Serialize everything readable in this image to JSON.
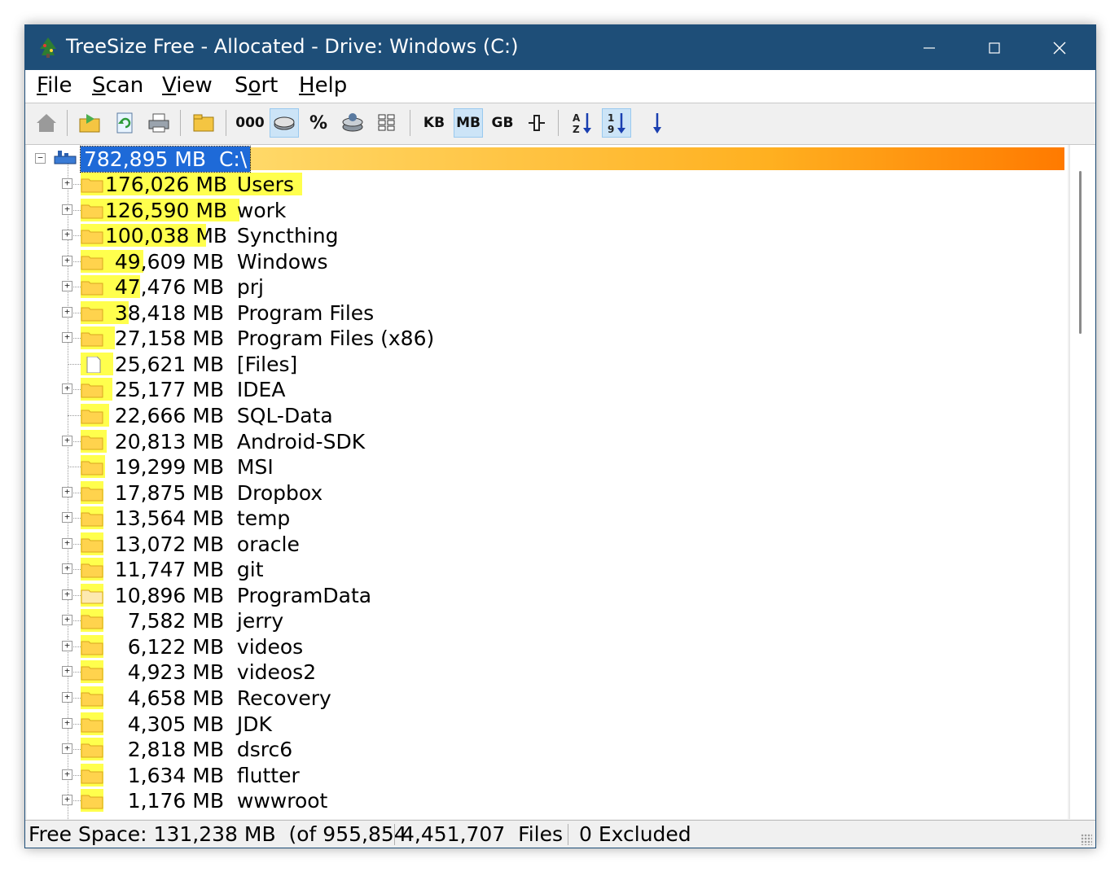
{
  "window": {
    "title": "TreeSize Free - Allocated - Drive: Windows (C:)",
    "controls": {
      "minimize": "–",
      "maximize": "☐",
      "close": "✕"
    }
  },
  "menu": {
    "items": [
      {
        "accel": "F",
        "rest": "ile"
      },
      {
        "accel": "S",
        "rest": "can"
      },
      {
        "accel": "V",
        "rest": "iew"
      },
      {
        "pre": "S",
        "accel": "o",
        "rest": "rt"
      },
      {
        "accel": "H",
        "rest": "elp"
      }
    ]
  },
  "toolbar": {
    "labels": {
      "thousands": "000",
      "percent": "%",
      "kb": "KB",
      "mb": "MB",
      "gb": "GB"
    },
    "active": [
      "size-view",
      "mb",
      "sort-size"
    ]
  },
  "tree": {
    "root": {
      "size": "782,895 MB",
      "name": "C:\\",
      "fraction": 1.0
    },
    "items": [
      {
        "size": "176,026 MB",
        "name": "Users",
        "fraction": 0.2248,
        "expandable": true,
        "type": "folder"
      },
      {
        "size": "126,590 MB",
        "name": "work",
        "fraction": 0.1617,
        "expandable": true,
        "type": "folder"
      },
      {
        "size": "100,038 MB",
        "name": "Syncthing",
        "fraction": 0.1278,
        "expandable": true,
        "type": "folder"
      },
      {
        "size": "49,609 MB",
        "name": "Windows",
        "fraction": 0.0634,
        "expandable": true,
        "type": "folder"
      },
      {
        "size": "47,476 MB",
        "name": "prj",
        "fraction": 0.0606,
        "expandable": true,
        "type": "folder"
      },
      {
        "size": "38,418 MB",
        "name": "Program Files",
        "fraction": 0.0491,
        "expandable": true,
        "type": "folder"
      },
      {
        "size": "27,158 MB",
        "name": "Program Files (x86)",
        "fraction": 0.0347,
        "expandable": true,
        "type": "folder"
      },
      {
        "size": "25,621 MB",
        "name": "[Files]",
        "fraction": 0.0327,
        "expandable": false,
        "type": "file"
      },
      {
        "size": "25,177 MB",
        "name": "IDEA",
        "fraction": 0.0322,
        "expandable": true,
        "type": "folder"
      },
      {
        "size": "22,666 MB",
        "name": "SQL-Data",
        "fraction": 0.029,
        "expandable": false,
        "type": "folder"
      },
      {
        "size": "20,813 MB",
        "name": "Android-SDK",
        "fraction": 0.0266,
        "expandable": true,
        "type": "folder"
      },
      {
        "size": "19,299 MB",
        "name": "MSI",
        "fraction": 0.0247,
        "expandable": false,
        "type": "folder"
      },
      {
        "size": "17,875 MB",
        "name": "Dropbox",
        "fraction": 0.0228,
        "expandable": true,
        "type": "folder"
      },
      {
        "size": "13,564 MB",
        "name": "temp",
        "fraction": 0.0173,
        "expandable": true,
        "type": "folder"
      },
      {
        "size": "13,072 MB",
        "name": "oracle",
        "fraction": 0.0167,
        "expandable": true,
        "type": "folder"
      },
      {
        "size": "11,747 MB",
        "name": "git",
        "fraction": 0.015,
        "expandable": true,
        "type": "folder"
      },
      {
        "size": "10,896 MB",
        "name": "ProgramData",
        "fraction": 0.0139,
        "expandable": true,
        "type": "folder-hidden"
      },
      {
        "size": "7,582 MB",
        "name": "jerry",
        "fraction": 0.0097,
        "expandable": true,
        "type": "folder"
      },
      {
        "size": "6,122 MB",
        "name": "videos",
        "fraction": 0.0078,
        "expandable": true,
        "type": "folder"
      },
      {
        "size": "4,923 MB",
        "name": "videos2",
        "fraction": 0.0063,
        "expandable": true,
        "type": "folder"
      },
      {
        "size": "4,658 MB",
        "name": "Recovery",
        "fraction": 0.006,
        "expandable": true,
        "type": "folder"
      },
      {
        "size": "4,305 MB",
        "name": "JDK",
        "fraction": 0.0055,
        "expandable": true,
        "type": "folder"
      },
      {
        "size": "2,818 MB",
        "name": "dsrc6",
        "fraction": 0.0036,
        "expandable": true,
        "type": "folder"
      },
      {
        "size": "1,634 MB",
        "name": "flutter",
        "fraction": 0.0021,
        "expandable": true,
        "type": "folder"
      },
      {
        "size": "1,176 MB",
        "name": "wwwroot",
        "fraction": 0.0015,
        "expandable": true,
        "type": "folder"
      }
    ]
  },
  "status": {
    "free_space": "Free Space: 131,238 MB  (of 955,854",
    "files": "4,451,707  Files",
    "excluded": "0 Excluded"
  },
  "colors": {
    "titlebar": "#1e4e78",
    "bar": "#ffff4d",
    "root_bar_start": "#ffe680",
    "root_bar_end": "#ff7a00",
    "selection": "#1e6ad8",
    "folder": "#ffd34d"
  }
}
